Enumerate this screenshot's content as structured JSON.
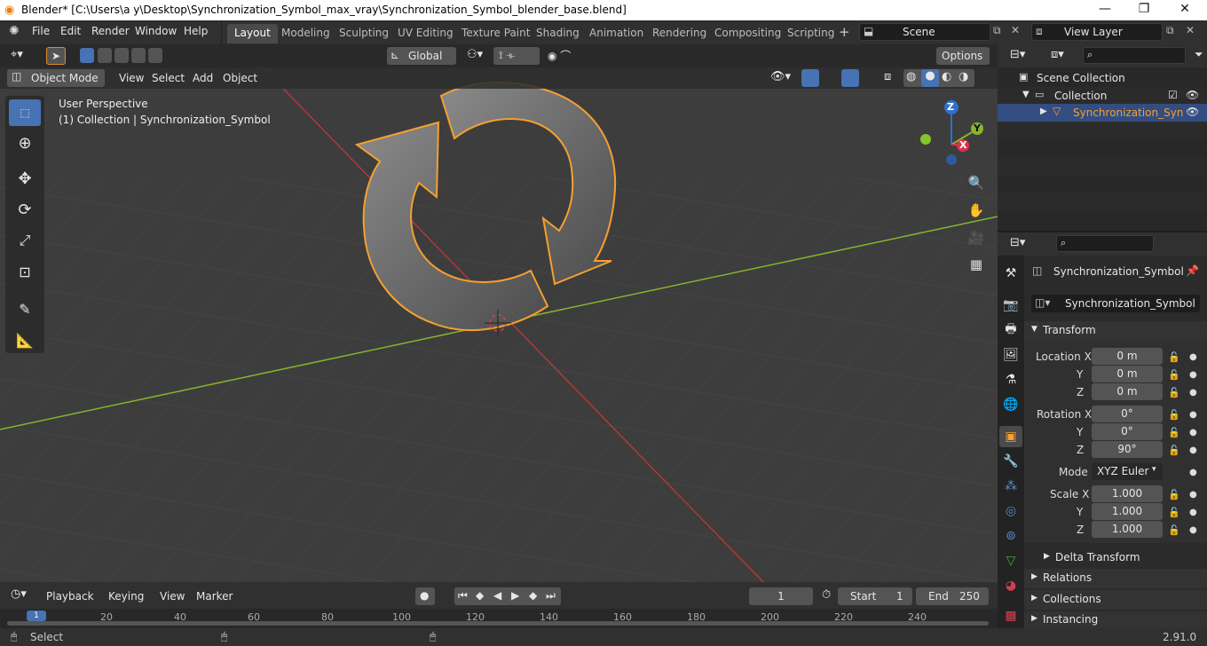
{
  "window": {
    "title": "Blender* [C:\\Users\\a y\\Desktop\\Synchronization_Symbol_max_vray\\Synchronization_Symbol_blender_base.blend]",
    "minimize": "—",
    "maximize": "❐",
    "close": "✕"
  },
  "menu": {
    "file": "File",
    "edit": "Edit",
    "render": "Render",
    "window": "Window",
    "help": "Help"
  },
  "workspaces": [
    "Layout",
    "Modeling",
    "Sculpting",
    "UV Editing",
    "Texture Paint",
    "Shading",
    "Animation",
    "Rendering",
    "Compositing",
    "Scripting"
  ],
  "scene": {
    "label": "Scene",
    "view_layer": "View Layer"
  },
  "viewport_header": {
    "orientation": "Global",
    "options": "Options",
    "mode": "Object Mode",
    "view": "View",
    "select": "Select",
    "add": "Add",
    "object": "Object"
  },
  "viewport_info": {
    "perspective": "User Perspective",
    "collection": "(1) Collection | Synchronization_Symbol"
  },
  "gizmo": {
    "x": "X",
    "y": "Y",
    "z": "Z"
  },
  "outliner": {
    "scene_collection": "Scene Collection",
    "collection": "Collection",
    "object": "Synchronization_Syn"
  },
  "properties": {
    "object_name": "Synchronization_Symbol",
    "datablock": "Synchronization_Symbol",
    "transform": "Transform",
    "location": {
      "label": "Location X",
      "y_label": "Y",
      "z_label": "Z",
      "x": "0 m",
      "y": "0 m",
      "z": "0 m"
    },
    "rotation": {
      "label": "Rotation X",
      "y_label": "Y",
      "z_label": "Z",
      "x": "0°",
      "y": "0°",
      "z": "90°"
    },
    "mode": {
      "label": "Mode",
      "value": "XYZ Euler"
    },
    "scale": {
      "label": "Scale X",
      "y_label": "Y",
      "z_label": "Z",
      "x": "1.000",
      "y": "1.000",
      "z": "1.000"
    },
    "delta_transform": "Delta Transform",
    "relations": "Relations",
    "collections": "Collections",
    "instancing": "Instancing"
  },
  "timeline": {
    "playback": "Playback",
    "keying": "Keying",
    "view": "View",
    "marker": "Marker",
    "current_frame": "1",
    "start_label": "Start",
    "start": "1",
    "end_label": "End",
    "end": "250",
    "ticks": [
      "1",
      "20",
      "40",
      "60",
      "80",
      "100",
      "120",
      "140",
      "160",
      "180",
      "200",
      "220",
      "240"
    ]
  },
  "status": {
    "select": "Select",
    "version": "2.91.0"
  },
  "colors": {
    "accent": "#4772b3",
    "selection_outline": "#f5a030",
    "viewport_bg": "#3d3d3d",
    "x_axis": "#d04040",
    "y_axis": "#86b42c"
  }
}
